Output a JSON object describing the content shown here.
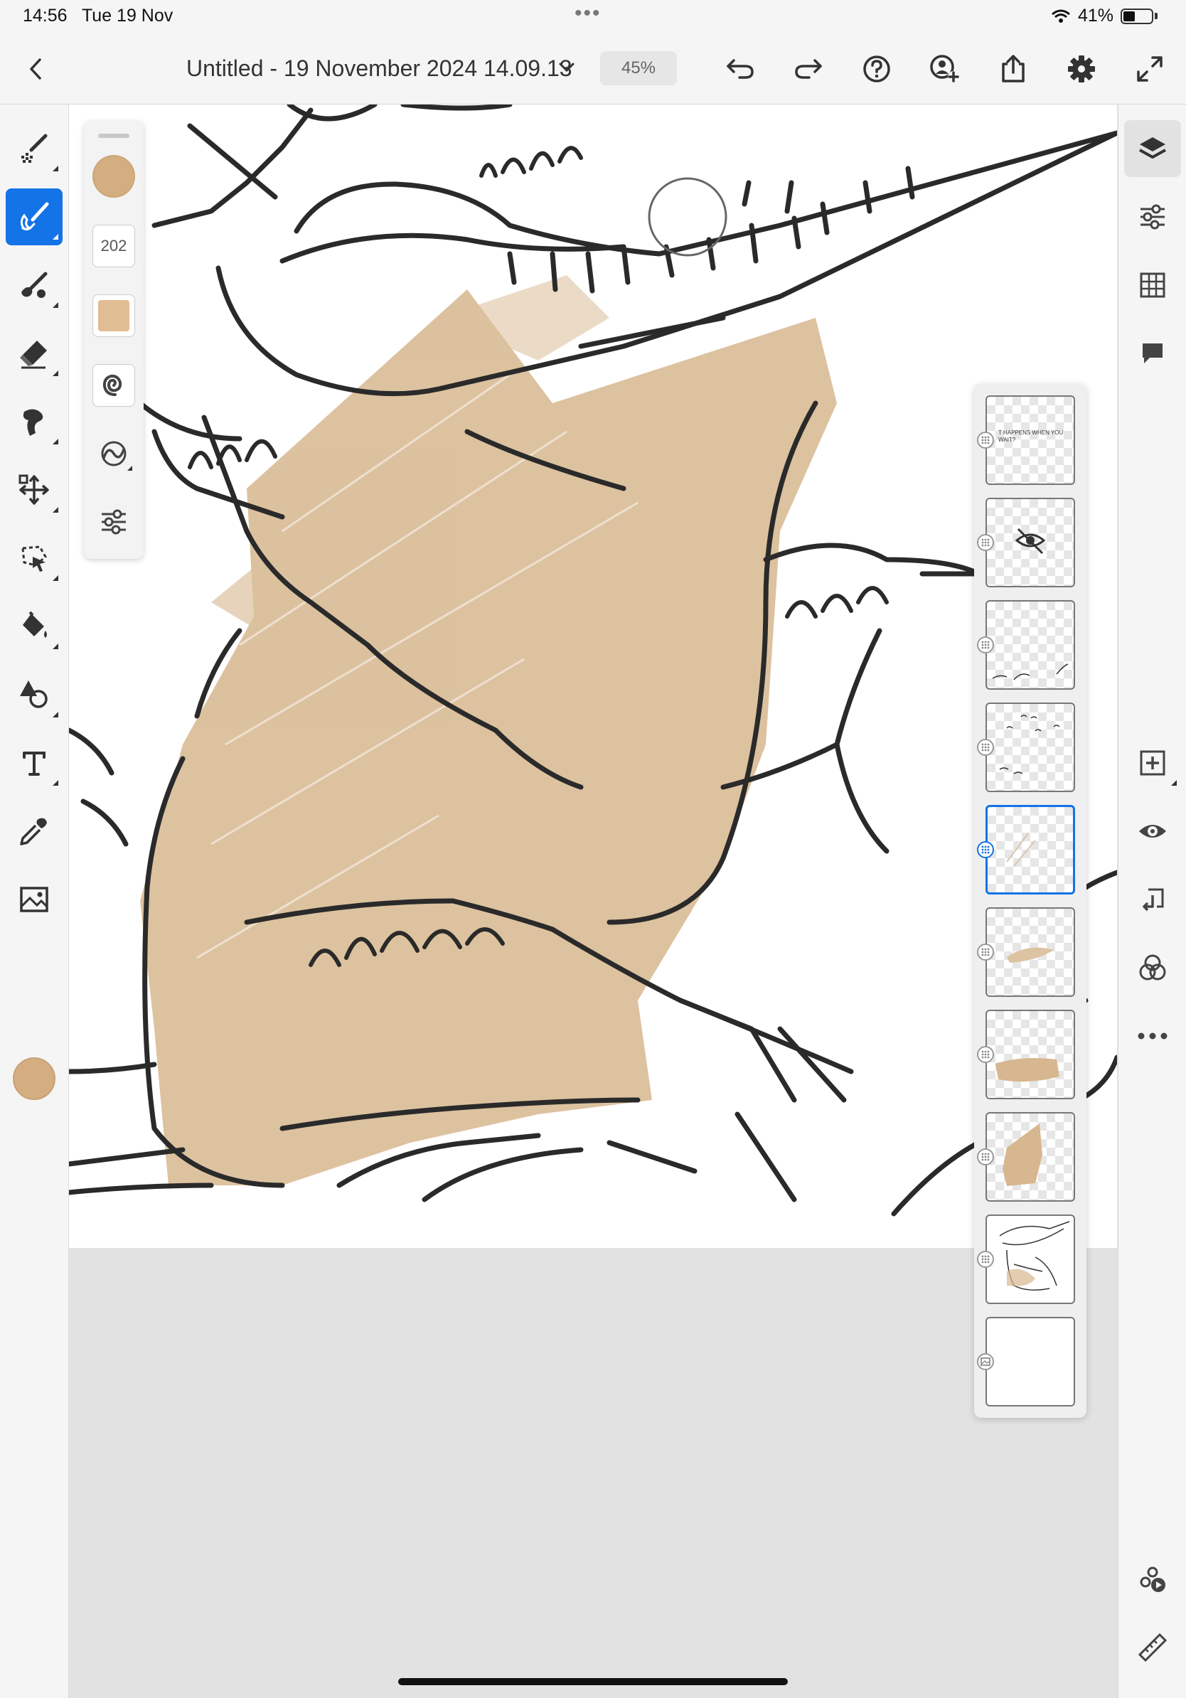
{
  "status_bar": {
    "time": "14:56",
    "date": "Tue 19 Nov",
    "battery": "41%"
  },
  "top_bar": {
    "title": "Untitled - 19 November 2024 14.09.13",
    "zoom": "45%",
    "icons": [
      "back-icon",
      "chevron-down-icon",
      "undo-icon",
      "redo-icon",
      "help-icon",
      "invite-icon",
      "share-icon",
      "settings-icon",
      "fullscreen-icon"
    ]
  },
  "left_toolbar": {
    "tools": [
      "pixel-brush",
      "paint-brush",
      "live-brush",
      "eraser",
      "smudge",
      "transform",
      "selection",
      "fill",
      "shapes",
      "text",
      "eyedropper",
      "image",
      "color"
    ],
    "active": "paint-brush",
    "color": "#d4ae80"
  },
  "brush_panel": {
    "size": "202",
    "color": "#d4ae80"
  },
  "right_toolbar": {
    "tools": [
      "layers",
      "layer-properties",
      "grid",
      "comments",
      "add-layer",
      "visibility",
      "merge-down",
      "blend",
      "more",
      "livestream",
      "ruler"
    ],
    "active": "layers"
  },
  "layers_panel": {
    "selected_index": 4,
    "layers": [
      {
        "thumb_text": "T HAPPENS WHEN YOU\nWAIT?"
      },
      {
        "thumb_icon": "hidden-eye-icon"
      },
      {
        "thumb_icon": "leaves-sketch"
      },
      {
        "thumb_icon": "scribble-marks"
      },
      {
        "thumb_icon": "faint-strokes"
      },
      {
        "thumb_icon": "tan-strokes"
      },
      {
        "thumb_icon": "tan-fill"
      },
      {
        "thumb_icon": "tan-body"
      },
      {
        "thumb_icon": "crocodile-sketch"
      },
      {
        "thumb_icon": "background"
      }
    ]
  },
  "colors": {
    "accent": "#1473e6",
    "paint": "#d4ae80"
  }
}
